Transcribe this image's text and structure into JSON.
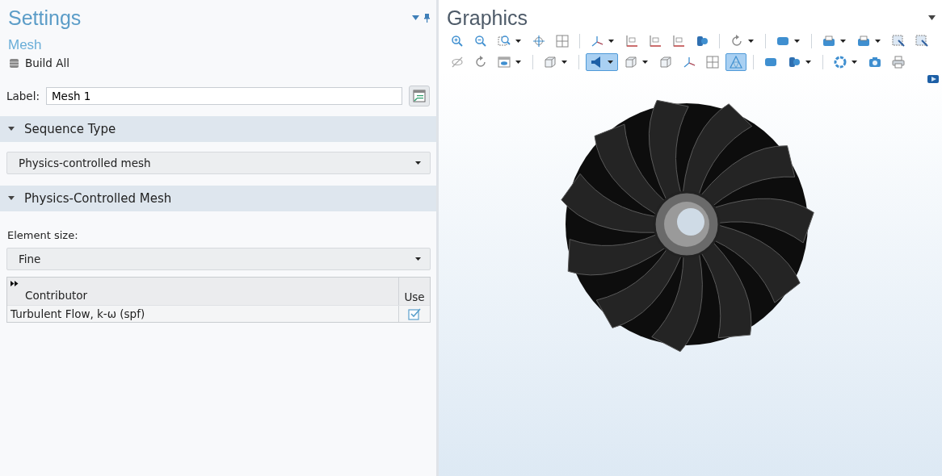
{
  "settings": {
    "title": "Settings",
    "node": "Mesh",
    "build_button": "Build All",
    "label_field": {
      "label": "Label:",
      "value": "Mesh 1"
    }
  },
  "sequence_type": {
    "title": "Sequence Type",
    "expanded": true,
    "select": "Physics-controlled mesh"
  },
  "physics_mesh": {
    "title": "Physics-Controlled Mesh",
    "expanded": true,
    "element_size_label": "Element size:",
    "element_size": "Fine",
    "table": {
      "columns": [
        "Contributor",
        "Use"
      ],
      "rows": [
        {
          "contributor": "Turbulent Flow, k-ω (spf)",
          "use": true
        }
      ]
    }
  },
  "graphics": {
    "title": "Graphics",
    "toolbar": [
      [
        {
          "kind": "zoom-in",
          "selected": false
        },
        {
          "kind": "zoom-out",
          "selected": false
        },
        {
          "kind": "zoom-box",
          "selected": false,
          "dropdown": true
        },
        {
          "kind": "move",
          "selected": false
        },
        {
          "kind": "grid",
          "selected": false
        },
        {
          "kind": "sep"
        },
        {
          "kind": "axes",
          "selected": false,
          "dropdown": true
        },
        {
          "kind": "plane",
          "selected": false
        },
        {
          "kind": "plane",
          "selected": false
        },
        {
          "kind": "plane",
          "selected": false
        },
        {
          "kind": "light",
          "selected": false
        },
        {
          "kind": "sep"
        },
        {
          "kind": "rotate",
          "selected": false,
          "dropdown": true
        },
        {
          "kind": "sep"
        },
        {
          "kind": "block",
          "selected": false,
          "dropdown": true
        },
        {
          "kind": "sep"
        },
        {
          "kind": "tray",
          "selected": false,
          "dropdown": true
        },
        {
          "kind": "tray",
          "selected": false,
          "dropdown": true
        },
        {
          "kind": "select",
          "selected": false
        },
        {
          "kind": "select",
          "selected": false
        }
      ],
      [
        {
          "kind": "eye",
          "selected": false
        },
        {
          "kind": "rotate",
          "selected": false
        },
        {
          "kind": "window",
          "selected": false,
          "dropdown": true
        },
        {
          "kind": "sep"
        },
        {
          "kind": "cube",
          "selected": false,
          "dropdown": true
        },
        {
          "kind": "sep"
        },
        {
          "kind": "speaker",
          "selected": true,
          "dropdown": true
        },
        {
          "kind": "cube",
          "selected": false,
          "dropdown": true
        },
        {
          "kind": "cube",
          "selected": false
        },
        {
          "kind": "axes",
          "selected": false
        },
        {
          "kind": "grid",
          "selected": false
        },
        {
          "kind": "triangle",
          "selected": true
        },
        {
          "kind": "sep"
        },
        {
          "kind": "block",
          "selected": false
        },
        {
          "kind": "light",
          "selected": false,
          "dropdown": true
        },
        {
          "kind": "sep"
        },
        {
          "kind": "aperture",
          "selected": false,
          "dropdown": true
        },
        {
          "kind": "camera",
          "selected": false
        },
        {
          "kind": "printer",
          "selected": false
        }
      ]
    ]
  }
}
